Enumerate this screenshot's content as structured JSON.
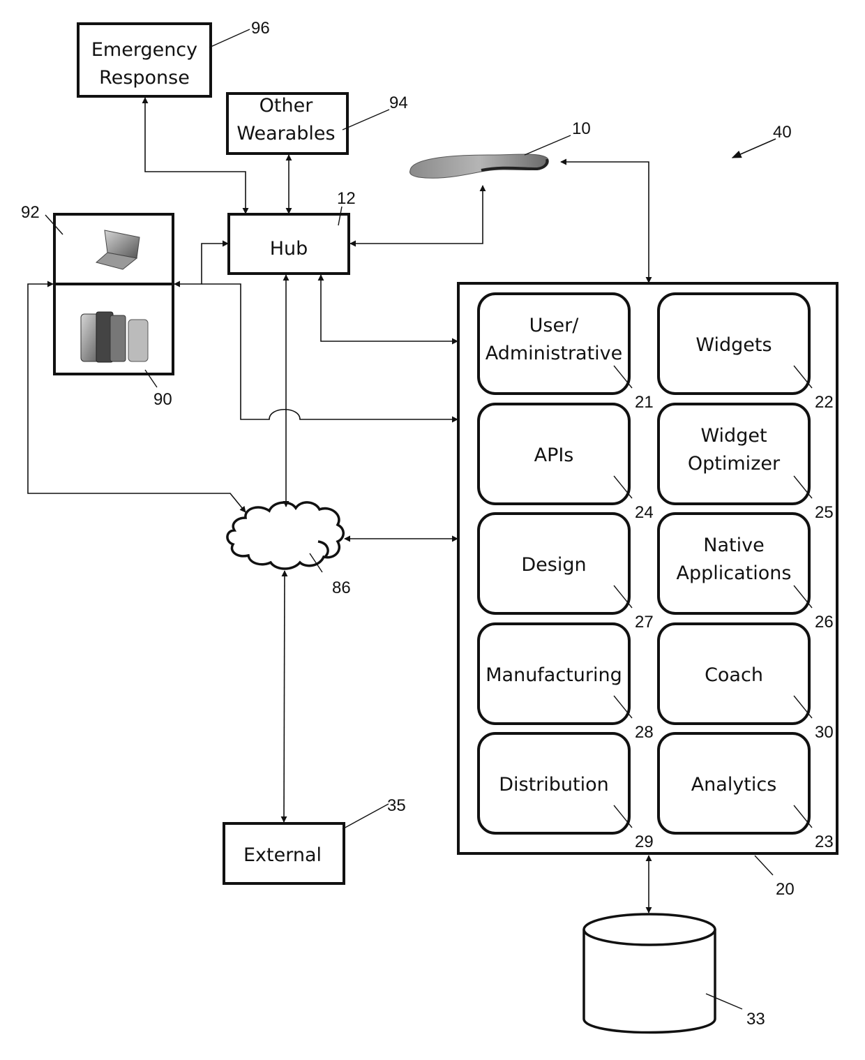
{
  "figure": {
    "system_ref": "40",
    "insole": {
      "ref": "10",
      "icon": "insole-icon"
    },
    "hub": {
      "label": "Hub",
      "ref": "12"
    },
    "emergency_response": {
      "line1": "Emergency",
      "line2": "Response",
      "ref": "96"
    },
    "other_wearables": {
      "line1": "Other",
      "line2": "Wearables",
      "ref": "94"
    },
    "laptop_device": {
      "ref": "92",
      "icon": "laptop-icon"
    },
    "mobile_devices": {
      "ref": "90",
      "icon": "mobile-phones-icon"
    },
    "network": {
      "ref": "86",
      "icon": "cloud-icon"
    },
    "external": {
      "label": "External",
      "ref": "35"
    },
    "platform": {
      "ref": "20"
    },
    "database": {
      "ref": "33",
      "icon": "database-cylinder-icon"
    },
    "modules": [
      {
        "line1": "User/",
        "line2": "Administrative",
        "ref": "21"
      },
      {
        "line1": "Widgets",
        "line2": "",
        "ref": "22"
      },
      {
        "line1": "APIs",
        "line2": "",
        "ref": "24"
      },
      {
        "line1": "Widget",
        "line2": "Optimizer",
        "ref": "25"
      },
      {
        "line1": "Design",
        "line2": "",
        "ref": "27"
      },
      {
        "line1": "Native",
        "line2": "Applications",
        "ref": "26"
      },
      {
        "line1": "Manufacturing",
        "line2": "",
        "ref": "28"
      },
      {
        "line1": "Coach",
        "line2": "",
        "ref": "30"
      },
      {
        "line1": "Distribution",
        "line2": "",
        "ref": "29"
      },
      {
        "line1": "Analytics",
        "line2": "",
        "ref": "23"
      }
    ]
  }
}
